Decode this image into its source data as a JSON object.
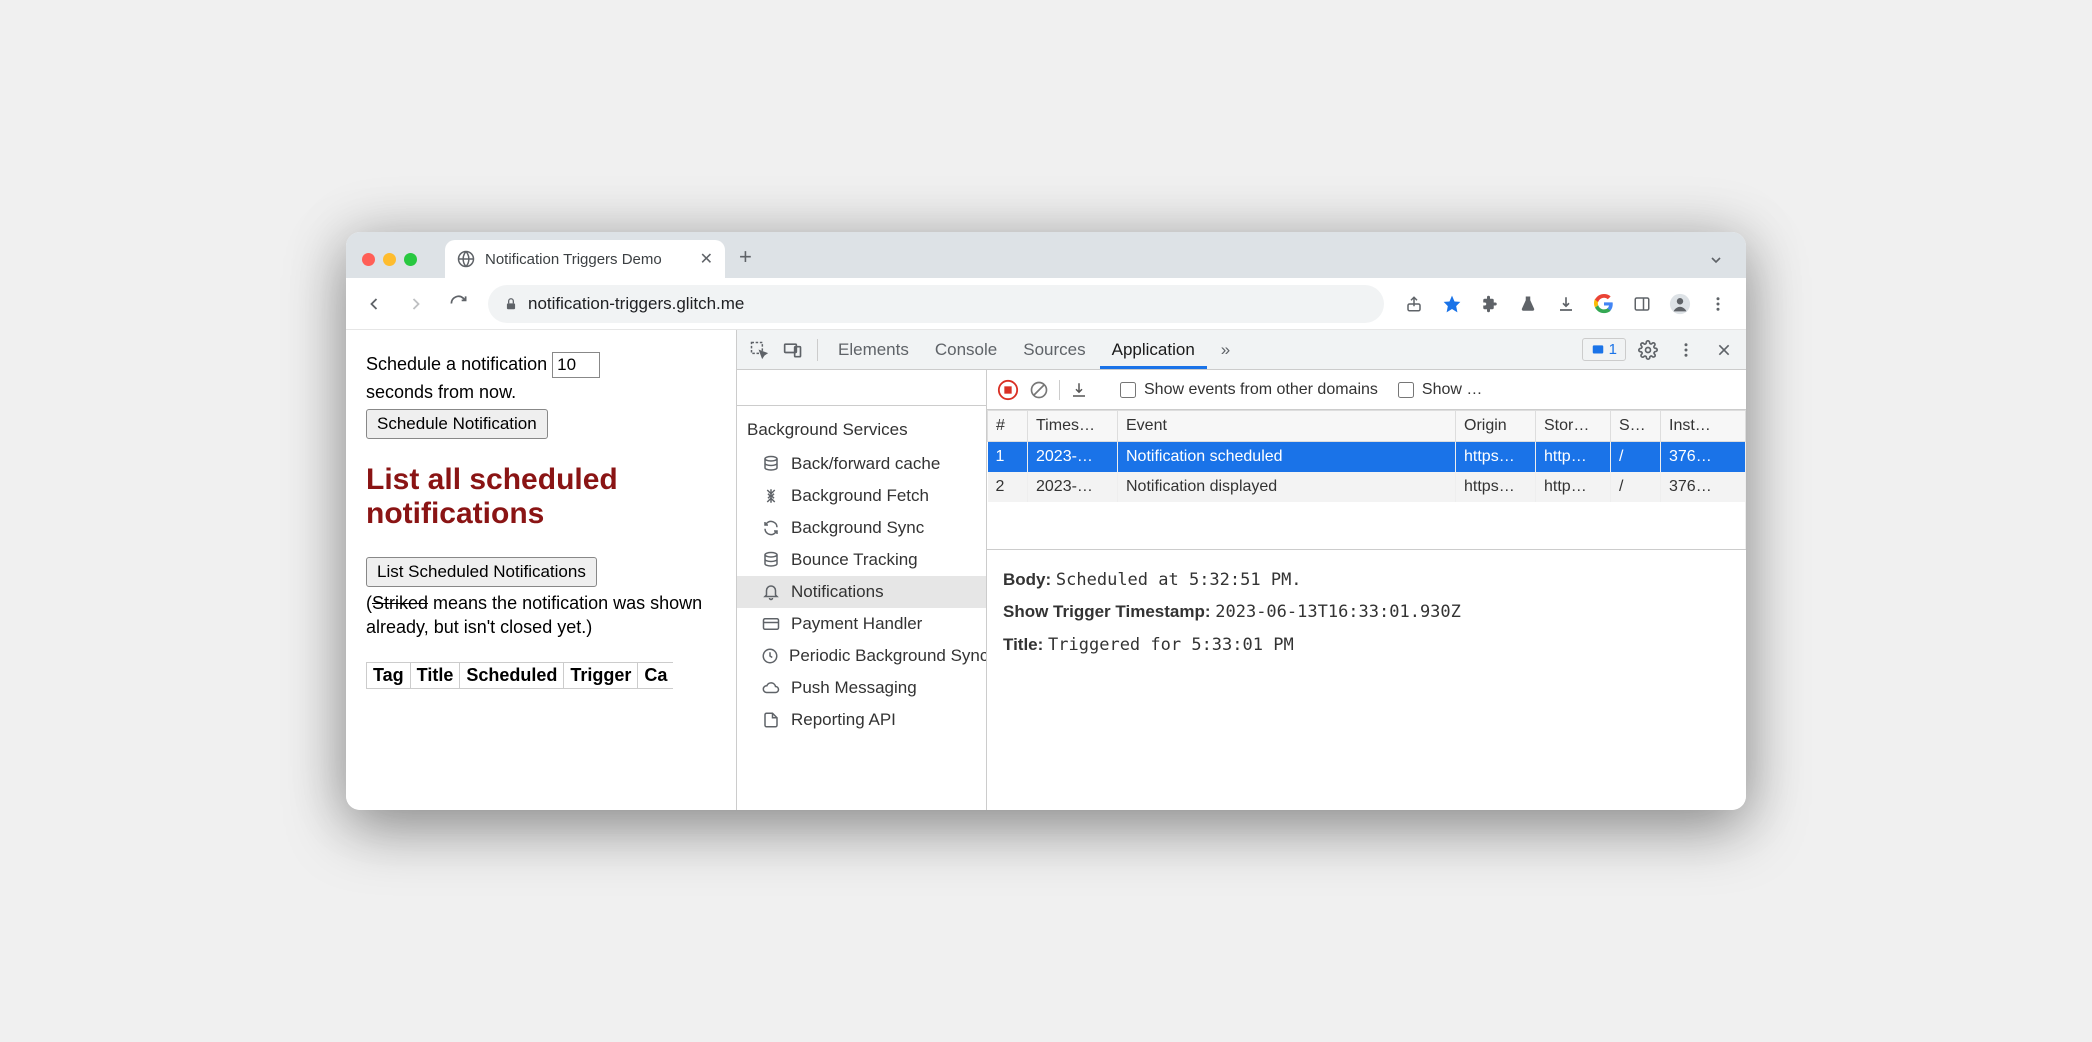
{
  "browser": {
    "tab_title": "Notification Triggers Demo",
    "url": "notification-triggers.glitch.me"
  },
  "page": {
    "schedule_prefix": "Schedule a notification",
    "schedule_value": "10",
    "schedule_suffix": "seconds from now.",
    "schedule_button": "Schedule Notification",
    "heading": "List all scheduled notifications",
    "list_button": "List Scheduled Notifications",
    "note_open": "(",
    "note_striked": "Striked",
    "note_rest": " means the notification was shown already, but isn't closed yet.)",
    "cols": [
      "Tag",
      "Title",
      "Scheduled",
      "Trigger",
      "Ca"
    ]
  },
  "devtools": {
    "tabs": [
      "Elements",
      "Console",
      "Sources",
      "Application"
    ],
    "more": "»",
    "issues_count": "1",
    "sidebar": {
      "group": "Background Services",
      "items": [
        "Back/forward cache",
        "Background Fetch",
        "Background Sync",
        "Bounce Tracking",
        "Notifications",
        "Payment Handler",
        "Periodic Background Sync",
        "Push Messaging",
        "Reporting API"
      ]
    },
    "events": {
      "show_other": "Show events from other domains",
      "show_trunc": "Show …",
      "headers": [
        "#",
        "Times…",
        "Event",
        "Origin",
        "Stor…",
        "S…",
        "Inst…"
      ],
      "rows": [
        {
          "n": "1",
          "ts": "2023-…",
          "event": "Notification scheduled",
          "origin": "https…",
          "storage": "http…",
          "s": "/",
          "inst": "376…"
        },
        {
          "n": "2",
          "ts": "2023-…",
          "event": "Notification displayed",
          "origin": "https…",
          "storage": "http…",
          "s": "/",
          "inst": "376…"
        }
      ]
    },
    "detail": {
      "body_k": "Body:",
      "body_v": "Scheduled at 5:32:51 PM.",
      "trig_k": "Show Trigger Timestamp:",
      "trig_v": "2023-06-13T16:33:01.930Z",
      "title_k": "Title:",
      "title_v": "Triggered for 5:33:01 PM"
    }
  }
}
